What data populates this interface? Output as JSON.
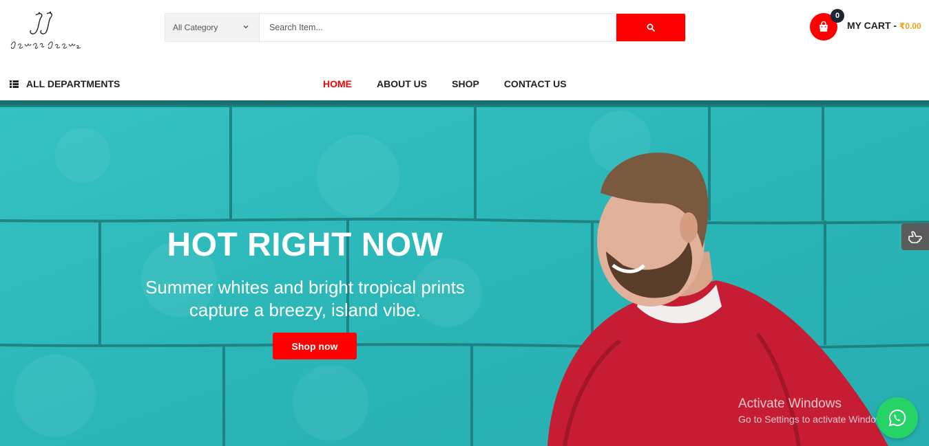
{
  "brand": {
    "logo_text": "Jonga Jeans"
  },
  "search": {
    "category_selected": "All Category",
    "placeholder": "Search Item..."
  },
  "cart": {
    "count": "0",
    "label": "MY CART - ",
    "amount": "₹0.00"
  },
  "departments": {
    "label": "ALL DEPARTMENTS"
  },
  "nav": {
    "items": [
      {
        "label": "HOME",
        "active": true
      },
      {
        "label": "ABOUT US",
        "active": false
      },
      {
        "label": "SHOP",
        "active": false
      },
      {
        "label": "CONTACT US",
        "active": false
      }
    ]
  },
  "hero": {
    "title": "HOT RIGHT NOW",
    "subtitle_line1": "Summer whites and bright tropical prints",
    "subtitle_line2": "capture a breezy, island vibe.",
    "cta": "Shop now"
  },
  "watermark": {
    "line1": "Activate Windows",
    "line2": "Go to Settings to activate Windows."
  },
  "colors": {
    "accent": "#ff0000",
    "cart_amount": "#f39c12",
    "hero_bg": "#2eb9b9",
    "whatsapp": "#25d366"
  },
  "icons": {
    "search": "search-icon",
    "cart": "shopping-bag-icon",
    "departments": "list-icon",
    "whatsapp": "whatsapp-icon",
    "side": "hand-pointer-icon"
  }
}
